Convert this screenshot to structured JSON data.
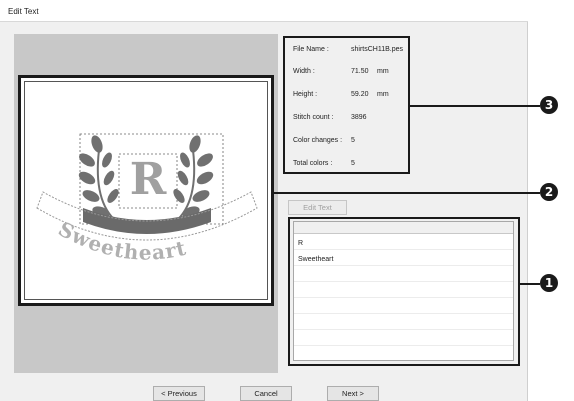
{
  "window": {
    "title": "Edit Text"
  },
  "info": {
    "rows": [
      {
        "label": "File Name :",
        "value": "shirtsCH11B.pes",
        "unit": ""
      },
      {
        "label": "Width :",
        "value": "71.50",
        "unit": "mm"
      },
      {
        "label": "Height :",
        "value": "59.20",
        "unit": "mm"
      },
      {
        "label": "Stitch count :",
        "value": "3896",
        "unit": ""
      },
      {
        "label": "Color changes :",
        "value": "5",
        "unit": ""
      },
      {
        "label": "Total colors :",
        "value": "5",
        "unit": ""
      }
    ]
  },
  "edit_text_button": "Edit Text",
  "text_list": {
    "items": [
      "R",
      "Sweetheart"
    ]
  },
  "design": {
    "letter": "R",
    "banner_text": "Sweetheart"
  },
  "buttons": {
    "previous": "< Previous",
    "cancel": "Cancel",
    "next": "Next >"
  },
  "callouts": [
    "1",
    "2",
    "3"
  ],
  "colors": {
    "dark_gray": "#707070",
    "light_gray": "#a8a8a8",
    "outline": "#1a1a1a"
  }
}
